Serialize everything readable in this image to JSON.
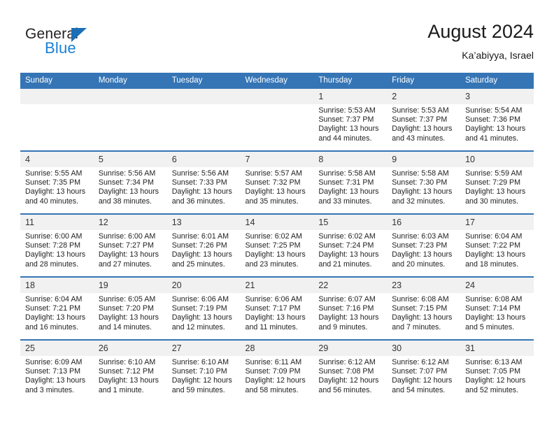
{
  "brand": {
    "word_one": "General",
    "word_two": "Blue",
    "triangle_color": "#1a6fb5",
    "blue_color": "#1a7fd4"
  },
  "header": {
    "title": "August 2024",
    "subtitle": "Ka’abiyya, Israel"
  },
  "theme": {
    "header_blue": "#3575b5",
    "day_band": "#f1f1f1",
    "text": "#222222"
  },
  "columns": [
    "Sunday",
    "Monday",
    "Tuesday",
    "Wednesday",
    "Thursday",
    "Friday",
    "Saturday"
  ],
  "weeks": [
    [
      {
        "day": "",
        "lines": []
      },
      {
        "day": "",
        "lines": []
      },
      {
        "day": "",
        "lines": []
      },
      {
        "day": "",
        "lines": []
      },
      {
        "day": "1",
        "lines": [
          "Sunrise: 5:53 AM",
          "Sunset: 7:37 PM",
          "Daylight: 13 hours",
          "and 44 minutes."
        ]
      },
      {
        "day": "2",
        "lines": [
          "Sunrise: 5:53 AM",
          "Sunset: 7:37 PM",
          "Daylight: 13 hours",
          "and 43 minutes."
        ]
      },
      {
        "day": "3",
        "lines": [
          "Sunrise: 5:54 AM",
          "Sunset: 7:36 PM",
          "Daylight: 13 hours",
          "and 41 minutes."
        ]
      }
    ],
    [
      {
        "day": "4",
        "lines": [
          "Sunrise: 5:55 AM",
          "Sunset: 7:35 PM",
          "Daylight: 13 hours",
          "and 40 minutes."
        ]
      },
      {
        "day": "5",
        "lines": [
          "Sunrise: 5:56 AM",
          "Sunset: 7:34 PM",
          "Daylight: 13 hours",
          "and 38 minutes."
        ]
      },
      {
        "day": "6",
        "lines": [
          "Sunrise: 5:56 AM",
          "Sunset: 7:33 PM",
          "Daylight: 13 hours",
          "and 36 minutes."
        ]
      },
      {
        "day": "7",
        "lines": [
          "Sunrise: 5:57 AM",
          "Sunset: 7:32 PM",
          "Daylight: 13 hours",
          "and 35 minutes."
        ]
      },
      {
        "day": "8",
        "lines": [
          "Sunrise: 5:58 AM",
          "Sunset: 7:31 PM",
          "Daylight: 13 hours",
          "and 33 minutes."
        ]
      },
      {
        "day": "9",
        "lines": [
          "Sunrise: 5:58 AM",
          "Sunset: 7:30 PM",
          "Daylight: 13 hours",
          "and 32 minutes."
        ]
      },
      {
        "day": "10",
        "lines": [
          "Sunrise: 5:59 AM",
          "Sunset: 7:29 PM",
          "Daylight: 13 hours",
          "and 30 minutes."
        ]
      }
    ],
    [
      {
        "day": "11",
        "lines": [
          "Sunrise: 6:00 AM",
          "Sunset: 7:28 PM",
          "Daylight: 13 hours",
          "and 28 minutes."
        ]
      },
      {
        "day": "12",
        "lines": [
          "Sunrise: 6:00 AM",
          "Sunset: 7:27 PM",
          "Daylight: 13 hours",
          "and 27 minutes."
        ]
      },
      {
        "day": "13",
        "lines": [
          "Sunrise: 6:01 AM",
          "Sunset: 7:26 PM",
          "Daylight: 13 hours",
          "and 25 minutes."
        ]
      },
      {
        "day": "14",
        "lines": [
          "Sunrise: 6:02 AM",
          "Sunset: 7:25 PM",
          "Daylight: 13 hours",
          "and 23 minutes."
        ]
      },
      {
        "day": "15",
        "lines": [
          "Sunrise: 6:02 AM",
          "Sunset: 7:24 PM",
          "Daylight: 13 hours",
          "and 21 minutes."
        ]
      },
      {
        "day": "16",
        "lines": [
          "Sunrise: 6:03 AM",
          "Sunset: 7:23 PM",
          "Daylight: 13 hours",
          "and 20 minutes."
        ]
      },
      {
        "day": "17",
        "lines": [
          "Sunrise: 6:04 AM",
          "Sunset: 7:22 PM",
          "Daylight: 13 hours",
          "and 18 minutes."
        ]
      }
    ],
    [
      {
        "day": "18",
        "lines": [
          "Sunrise: 6:04 AM",
          "Sunset: 7:21 PM",
          "Daylight: 13 hours",
          "and 16 minutes."
        ]
      },
      {
        "day": "19",
        "lines": [
          "Sunrise: 6:05 AM",
          "Sunset: 7:20 PM",
          "Daylight: 13 hours",
          "and 14 minutes."
        ]
      },
      {
        "day": "20",
        "lines": [
          "Sunrise: 6:06 AM",
          "Sunset: 7:19 PM",
          "Daylight: 13 hours",
          "and 12 minutes."
        ]
      },
      {
        "day": "21",
        "lines": [
          "Sunrise: 6:06 AM",
          "Sunset: 7:17 PM",
          "Daylight: 13 hours",
          "and 11 minutes."
        ]
      },
      {
        "day": "22",
        "lines": [
          "Sunrise: 6:07 AM",
          "Sunset: 7:16 PM",
          "Daylight: 13 hours",
          "and 9 minutes."
        ]
      },
      {
        "day": "23",
        "lines": [
          "Sunrise: 6:08 AM",
          "Sunset: 7:15 PM",
          "Daylight: 13 hours",
          "and 7 minutes."
        ]
      },
      {
        "day": "24",
        "lines": [
          "Sunrise: 6:08 AM",
          "Sunset: 7:14 PM",
          "Daylight: 13 hours",
          "and 5 minutes."
        ]
      }
    ],
    [
      {
        "day": "25",
        "lines": [
          "Sunrise: 6:09 AM",
          "Sunset: 7:13 PM",
          "Daylight: 13 hours",
          "and 3 minutes."
        ]
      },
      {
        "day": "26",
        "lines": [
          "Sunrise: 6:10 AM",
          "Sunset: 7:12 PM",
          "Daylight: 13 hours",
          "and 1 minute."
        ]
      },
      {
        "day": "27",
        "lines": [
          "Sunrise: 6:10 AM",
          "Sunset: 7:10 PM",
          "Daylight: 12 hours",
          "and 59 minutes."
        ]
      },
      {
        "day": "28",
        "lines": [
          "Sunrise: 6:11 AM",
          "Sunset: 7:09 PM",
          "Daylight: 12 hours",
          "and 58 minutes."
        ]
      },
      {
        "day": "29",
        "lines": [
          "Sunrise: 6:12 AM",
          "Sunset: 7:08 PM",
          "Daylight: 12 hours",
          "and 56 minutes."
        ]
      },
      {
        "day": "30",
        "lines": [
          "Sunrise: 6:12 AM",
          "Sunset: 7:07 PM",
          "Daylight: 12 hours",
          "and 54 minutes."
        ]
      },
      {
        "day": "31",
        "lines": [
          "Sunrise: 6:13 AM",
          "Sunset: 7:05 PM",
          "Daylight: 12 hours",
          "and 52 minutes."
        ]
      }
    ]
  ]
}
